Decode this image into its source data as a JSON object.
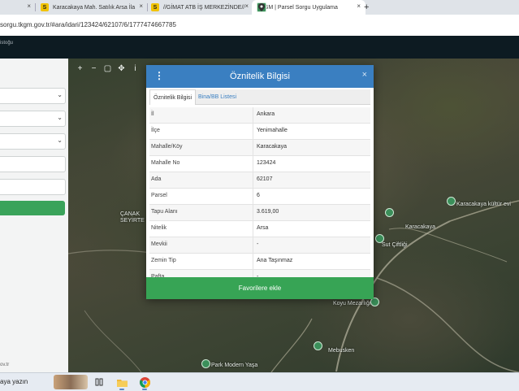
{
  "browser": {
    "tabs": [
      {
        "icon": "close-icon",
        "label": "",
        "close": "×"
      },
      {
        "icon": "s-favicon",
        "label": "Karacakaya Mah. Satılık Arsa İla",
        "close": "×"
      },
      {
        "icon": "s-favicon",
        "label": "//GİMAT ATB İŞ MERKEZİNDE//",
        "close": "×"
      },
      {
        "icon": "location-pin-icon",
        "label": "TKGM | Parsel Sorgu Uygulama",
        "close": "×"
      }
    ],
    "new_tab": "+",
    "favicon_letter": "S",
    "url": "sorgu.tkgm.gov.tr/#ara/idari/123424/62107/6/1777474667785"
  },
  "app_header": {
    "text": "istoğu"
  },
  "map": {
    "tools": [
      "+",
      "−",
      "▢",
      "✥",
      "i",
      "⊡"
    ],
    "labels": [
      "Karacakaya",
      "Karacakaya kültür evi",
      "ÇANAK",
      "SEYİRTE",
      "Sut Çiftliği",
      "Koyu Mezarlığı",
      "Mebusken",
      "Park Modern Yaşa"
    ]
  },
  "left_panel": {
    "chevron": "⌄",
    "footer": "ov.tr"
  },
  "modal": {
    "title": "Öznitelik Bilgisi",
    "menu_icon": "⋮",
    "close": "×",
    "tabs": [
      "Öznitelik Bilgisi",
      "Bina/BB Listesi"
    ],
    "rows": [
      {
        "key": "İl",
        "value": "Ankara"
      },
      {
        "key": "İlçe",
        "value": "Yenimahalle"
      },
      {
        "key": "Mahalle/Köy",
        "value": "Karacakaya"
      },
      {
        "key": "Mahalle No",
        "value": "123424"
      },
      {
        "key": "Ada",
        "value": "62107"
      },
      {
        "key": "Parsel",
        "value": "6"
      },
      {
        "key": "Tapu Alanı",
        "value": "3.619,00"
      },
      {
        "key": "Nitelik",
        "value": "Arsa"
      },
      {
        "key": "Mevkii",
        "value": "-"
      },
      {
        "key": "Zemin Tip",
        "value": "Ana Taşınmaz"
      },
      {
        "key": "Pafta",
        "value": "-"
      }
    ],
    "favorite_button": "Favorilere ekle"
  },
  "taskbar": {
    "search_text": "aya yazın",
    "icons": [
      "task-view-icon",
      "file-explorer-icon",
      "chrome-icon"
    ]
  },
  "colors": {
    "modal_header": "#3a7fc1",
    "accent_green": "#37a455",
    "tab_link": "#3a7fc1"
  }
}
